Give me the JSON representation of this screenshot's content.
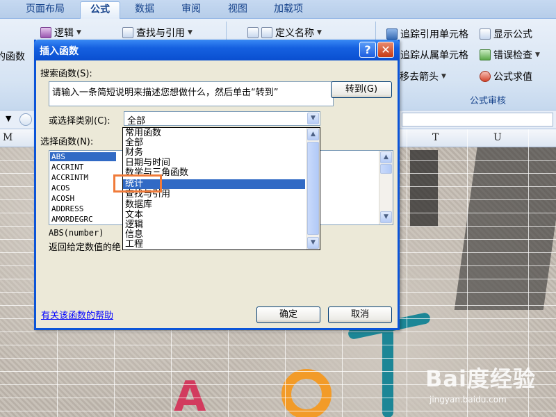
{
  "ribbon": {
    "tabs": [
      {
        "label": "页面布局",
        "active": false
      },
      {
        "label": "公式",
        "active": true
      },
      {
        "label": "数据",
        "active": false
      },
      {
        "label": "审阅",
        "active": false
      },
      {
        "label": "视图",
        "active": false
      },
      {
        "label": "加载项",
        "active": false
      }
    ],
    "buttons": {
      "logic": "逻辑",
      "lookup": "查找与引用",
      "define_name": "定义名称",
      "functions_cut": "的函数",
      "trace_precedents": "追踪引用单元格",
      "trace_dependents": "追踪从属单元格",
      "remove_arrows": "移去箭头",
      "show_formulas": "显示公式",
      "error_check": "错误检查",
      "evaluate": "公式求值"
    },
    "group_label": "公式审核"
  },
  "sheet": {
    "column_headers": [
      "M",
      "T",
      "U"
    ]
  },
  "dialog": {
    "title": "插入函数",
    "help_symbol": "?",
    "close_symbol": "✕",
    "search_label": "搜索函数(S):",
    "search_value": "请输入一条简短说明来描述您想做什么，然后单击“转到”",
    "goto_button": "转到(G)",
    "category_label": "或选择类别(C):",
    "category_value": "全部",
    "select_label": "选择函数(N):",
    "functions": [
      "ABS",
      "ACCRINT",
      "ACCRINTM",
      "ACOS",
      "ACOSH",
      "ADDRESS",
      "AMORDEGRC"
    ],
    "signature": "ABS(number)",
    "description": "返回给定数值的绝",
    "help_link": "有关该函数的帮助",
    "ok_button": "确定",
    "cancel_button": "取消"
  },
  "category_dropdown": {
    "items": [
      "常用函数",
      "全部",
      "财务",
      "日期与时间",
      "数学与三角函数",
      "统计",
      "查找与引用",
      "数据库",
      "文本",
      "逻辑",
      "信息",
      "工程"
    ],
    "selected_index": 5
  },
  "watermark": {
    "logo": "Bai度经验",
    "url": "jingyan.baidu.com"
  },
  "colors": {
    "title_bar": "#0a4fd0",
    "selection": "#316ac5",
    "highlight": "#f07b3a",
    "dialog_bg": "#ece9d8"
  }
}
